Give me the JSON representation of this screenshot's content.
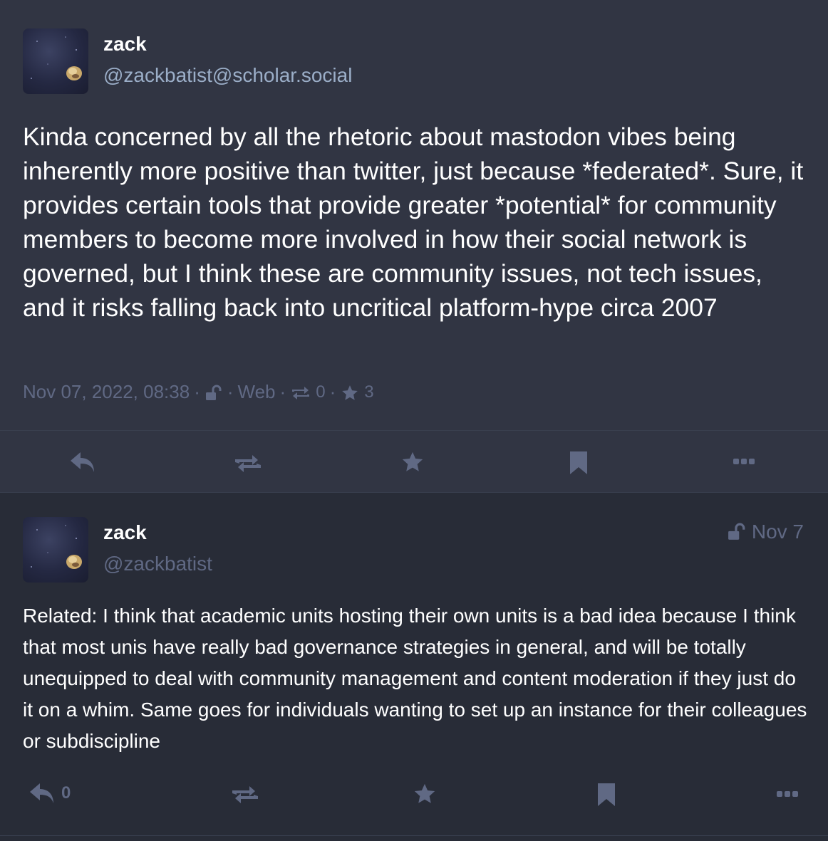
{
  "main_status": {
    "display_name": "zack",
    "account": "@zackbatist@scholar.social",
    "content": "Kinda concerned by all the rhetoric about mastodon vibes being inherently more positive than twitter, just because *federated*. Sure, it provides certain tools that provide greater *potential* for community members to become more involved in how their social network is governed, but I think these are community issues, not tech issues, and it risks falling back into uncritical platform-hype circa 2007",
    "timestamp": "Nov 07, 2022, 08:38",
    "visibility_icon": "unlocked-icon",
    "application": "Web",
    "reblog_count": "0",
    "favourite_count": "3"
  },
  "reply_status": {
    "display_name": "zack",
    "account": "@zackbatist",
    "relative_time": "Nov 7",
    "visibility_icon": "unlocked-icon",
    "content": "Related: I think that academic units hosting their own units is a bad idea because I think that most unis have really bad governance strategies in general, and will be totally unequipped to deal with community management and content moderation if they just do it on a whim. Same goes for individuals wanting to set up an instance for their colleagues or subdiscipline",
    "reply_count": "0"
  },
  "colors": {
    "background": "#282c37",
    "focused_background": "#313543",
    "text": "#ffffff",
    "secondary_text": "#9baec8",
    "muted_text": "#606984"
  },
  "separator": "·"
}
